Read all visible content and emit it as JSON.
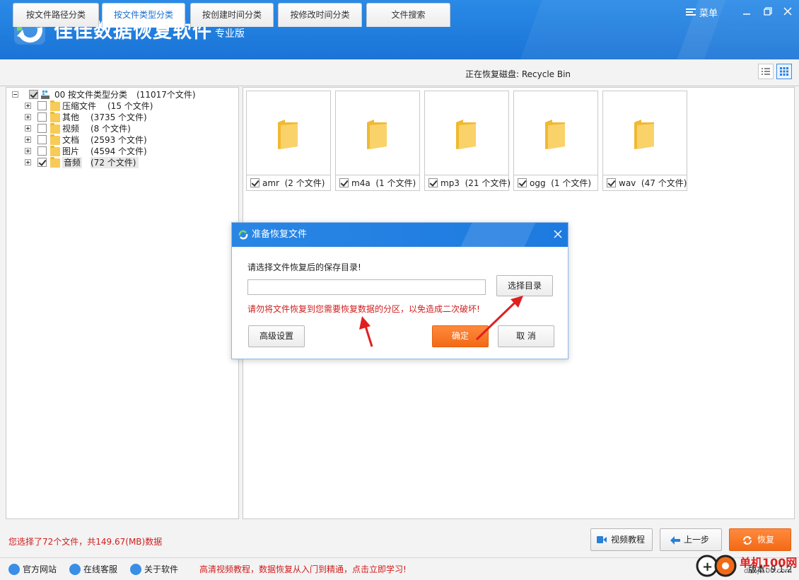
{
  "app": {
    "title": "佳佳数据恢复软件",
    "edition": "专业版",
    "menu_label": "菜单"
  },
  "tabs": [
    {
      "label": "按文件路径分类",
      "active": false
    },
    {
      "label": "按文件类型分类",
      "active": true
    },
    {
      "label": "按创建时间分类",
      "active": false
    },
    {
      "label": "按修改时间分类",
      "active": false
    },
    {
      "label": "文件搜索",
      "active": false
    }
  ],
  "recovering_disk": "正在恢复磁盘: Recycle Bin",
  "tree": {
    "root": {
      "id": "00",
      "label": "按文件类型分类",
      "count": "(11017个文件)"
    },
    "items": [
      {
        "label": "压缩文件",
        "count": "(15 个文件)",
        "checked": false
      },
      {
        "label": "其他",
        "count": "(3735 个文件)",
        "checked": false
      },
      {
        "label": "视频",
        "count": "(8 个文件)",
        "checked": false
      },
      {
        "label": "文档",
        "count": "(2593 个文件)",
        "checked": false
      },
      {
        "label": "图片",
        "count": "(4594 个文件)",
        "checked": false
      },
      {
        "label": "音频",
        "count": "(72 个文件)",
        "checked": true
      }
    ]
  },
  "tiles": [
    {
      "label": "amr",
      "count": "(2 个文件)",
      "checked": true
    },
    {
      "label": "m4a",
      "count": "(1 个文件)",
      "checked": true
    },
    {
      "label": "mp3",
      "count": "(21 个文件)",
      "checked": true
    },
    {
      "label": "ogg",
      "count": "(1 个文件)",
      "checked": true
    },
    {
      "label": "wav",
      "count": "(47 个文件)",
      "checked": true
    }
  ],
  "dialog": {
    "title": "准备恢复文件",
    "prompt": "请选择文件恢复后的保存目录!",
    "path_value": "",
    "choose_dir": "选择目录",
    "warning": "请勿将文件恢复到您需要恢复数据的分区，以免造成二次破坏!",
    "advanced": "高级设置",
    "confirm": "确定",
    "cancel": "取 消"
  },
  "status": {
    "selection": "您选择了72个文件，共149.67(MB)数据"
  },
  "nav_buttons": {
    "video": "视频教程",
    "prev": "上一步",
    "recover": "恢复"
  },
  "footer": {
    "links": [
      "官方网站",
      "在线客服",
      "关于软件"
    ],
    "promo": "高清视频教程，数据恢复从入门到精通，点击立即学习!",
    "version": "版本: 9.1.2"
  },
  "watermark": {
    "text": "单机100网",
    "sub": "danji100.com"
  },
  "colors": {
    "accent": "#1a74d6",
    "orange": "#f26a16",
    "warn": "#d01c1c"
  }
}
